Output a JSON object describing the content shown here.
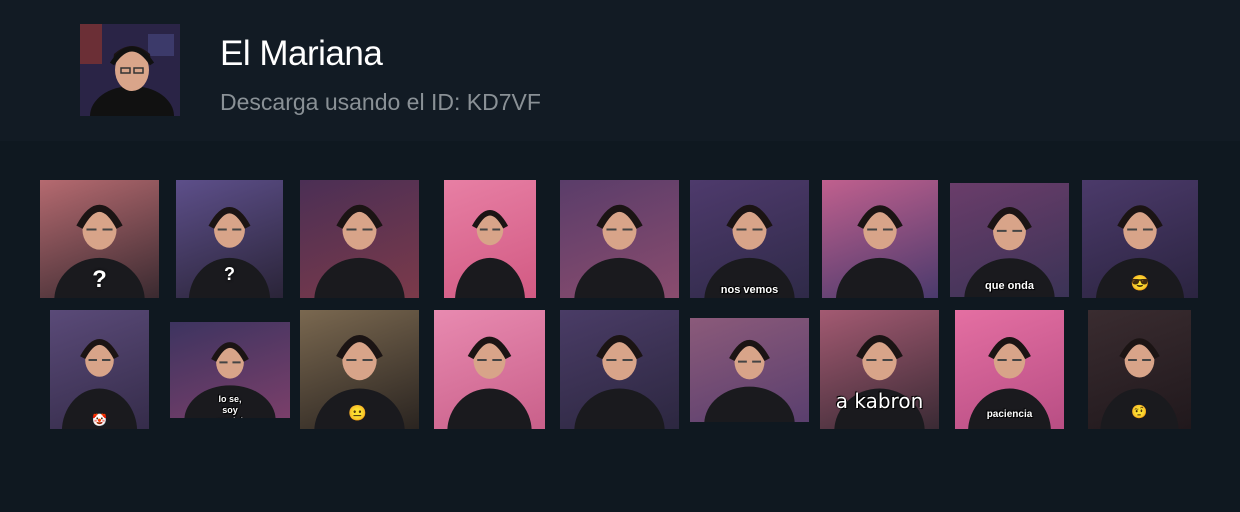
{
  "pack": {
    "name": "El Mariana",
    "subtitle": "Descarga usando el ID: KD7VF"
  },
  "stickers": [
    {
      "id": "s1",
      "caption": "?",
      "emoji": "",
      "colors": [
        "#b56a70",
        "#3a2a30"
      ]
    },
    {
      "id": "s2",
      "caption": "?",
      "emoji": "",
      "colors": [
        "#5d4f8a",
        "#2a2438"
      ]
    },
    {
      "id": "s3",
      "caption": "",
      "emoji": "",
      "colors": [
        "#4b2f55",
        "#7b3a4a"
      ]
    },
    {
      "id": "s4",
      "caption": "",
      "emoji": "",
      "colors": [
        "#e77fa4",
        "#d25a83"
      ]
    },
    {
      "id": "s5",
      "caption": "",
      "emoji": "",
      "colors": [
        "#5a3d6a",
        "#8a4c6e"
      ]
    },
    {
      "id": "s6",
      "caption": "nos vemos",
      "emoji": "",
      "colors": [
        "#4e3a6c",
        "#2f2a48"
      ]
    },
    {
      "id": "s7",
      "caption": "",
      "emoji": "",
      "colors": [
        "#c0608e",
        "#4a3a6c"
      ]
    },
    {
      "id": "s8",
      "caption": "que onda",
      "emoji": "",
      "colors": [
        "#6a3d6a",
        "#3b3356"
      ]
    },
    {
      "id": "s9",
      "caption": "",
      "emoji": "😎",
      "colors": [
        "#4b3a6a",
        "#2b2440"
      ]
    },
    {
      "id": "s10",
      "caption": "",
      "emoji": "🤡",
      "colors": [
        "#5a4a78",
        "#352c4a"
      ]
    },
    {
      "id": "s11",
      "caption": "lo se, soy genial",
      "emoji": "",
      "colors": [
        "#3d3460",
        "#7a3f6a"
      ]
    },
    {
      "id": "s12",
      "caption": "",
      "emoji": "😐",
      "colors": [
        "#7a6850",
        "#2a2420"
      ]
    },
    {
      "id": "s13",
      "caption": "",
      "emoji": "",
      "colors": [
        "#e88ab0",
        "#c9608a"
      ]
    },
    {
      "id": "s14",
      "caption": "",
      "emoji": "",
      "colors": [
        "#4a3c66",
        "#2c2740"
      ]
    },
    {
      "id": "s15",
      "caption": "",
      "emoji": "",
      "colors": [
        "#8b5a7a",
        "#5a3f6e"
      ]
    },
    {
      "id": "s16",
      "caption": "a kabron",
      "emoji": "",
      "colors": [
        "#a35a72",
        "#3a2a34"
      ]
    },
    {
      "id": "s17",
      "caption": "paciencia",
      "emoji": "",
      "colors": [
        "#e46fa2",
        "#b84e84"
      ]
    },
    {
      "id": "s18",
      "caption": "",
      "emoji": "🤨",
      "colors": [
        "#3a2c30",
        "#20181c"
      ]
    }
  ]
}
